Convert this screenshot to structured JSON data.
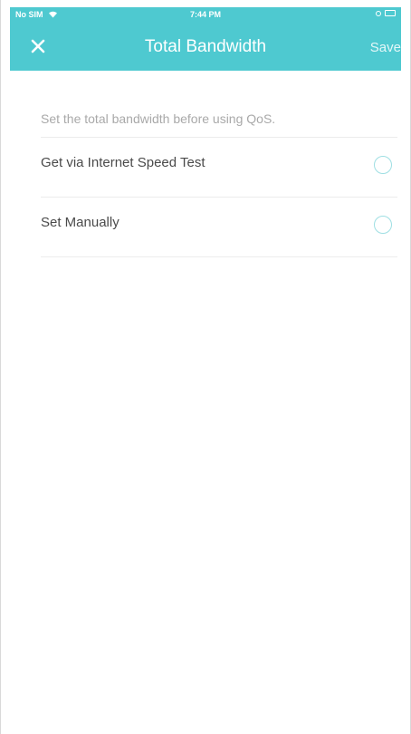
{
  "status_bar": {
    "carrier": "No SIM",
    "time": "7:44 PM",
    "icons": [
      "wifi-icon",
      "location-icon",
      "battery-icon"
    ]
  },
  "header": {
    "title": "Total Bandwidth",
    "close_icon": "close-icon",
    "save_label": "Save"
  },
  "main": {
    "hint": "Set the total bandwidth before using QoS.",
    "options": [
      {
        "label": "Get via Internet Speed Test",
        "selected": false
      },
      {
        "label": "Set Manually",
        "selected": false
      }
    ]
  },
  "colors": {
    "accent": "#4ec9d0",
    "radio_border": "#9fdfe3",
    "text": "#4a4a4a",
    "hint_text": "#a9a9a9"
  }
}
